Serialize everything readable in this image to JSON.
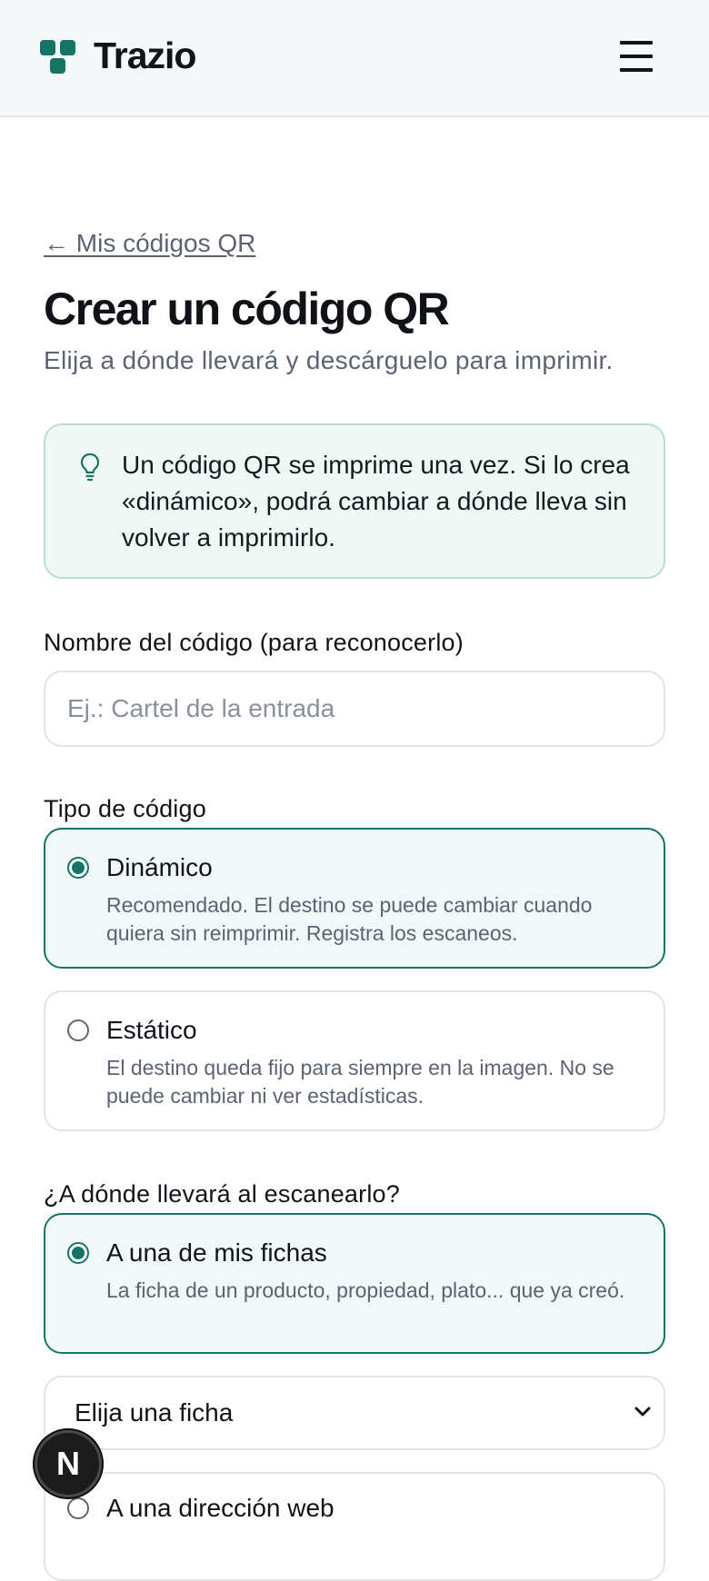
{
  "header": {
    "brand": "Trazio",
    "logo_icon": "logo-icon",
    "menu_icon": "hamburger-menu-icon",
    "brand_color": "#157565"
  },
  "page": {
    "back_link": "← Mis códigos QR",
    "title": "Crear un código QR",
    "subtitle": "Elija a dónde llevará y descárguelo para imprimir."
  },
  "tip": {
    "icon": "lightbulb-icon",
    "text": "Un código QR se imprime una vez. Si lo crea «dinámico», podrá cambiar a dónde lleva sin volver a imprimirlo."
  },
  "name_field": {
    "label": "Nombre del código (para reconocerlo)",
    "placeholder": "Ej.: Cartel de la entrada",
    "value": ""
  },
  "code_type": {
    "label": "Tipo de código",
    "options": [
      {
        "title": "Dinámico",
        "description": "Recomendado. El destino se puede cambiar cuando quiera sin reimprimir. Registra los escaneos.",
        "selected": true
      },
      {
        "title": "Estático",
        "description": "El destino queda fijo para siempre en la imagen. No se puede cambiar ni ver estadísticas.",
        "selected": false
      }
    ]
  },
  "destination": {
    "label": "¿A dónde llevará al escanearlo?",
    "options": [
      {
        "title": "A una de mis fichas",
        "description": "La ficha de un producto, propiedad, plato... que ya creó.",
        "selected": true
      },
      {
        "title": "A una dirección web",
        "selected": false
      }
    ],
    "select": {
      "value": "Elija una ficha",
      "icon": "chevron-down-icon"
    }
  },
  "dev_badge": {
    "letter": "N"
  }
}
